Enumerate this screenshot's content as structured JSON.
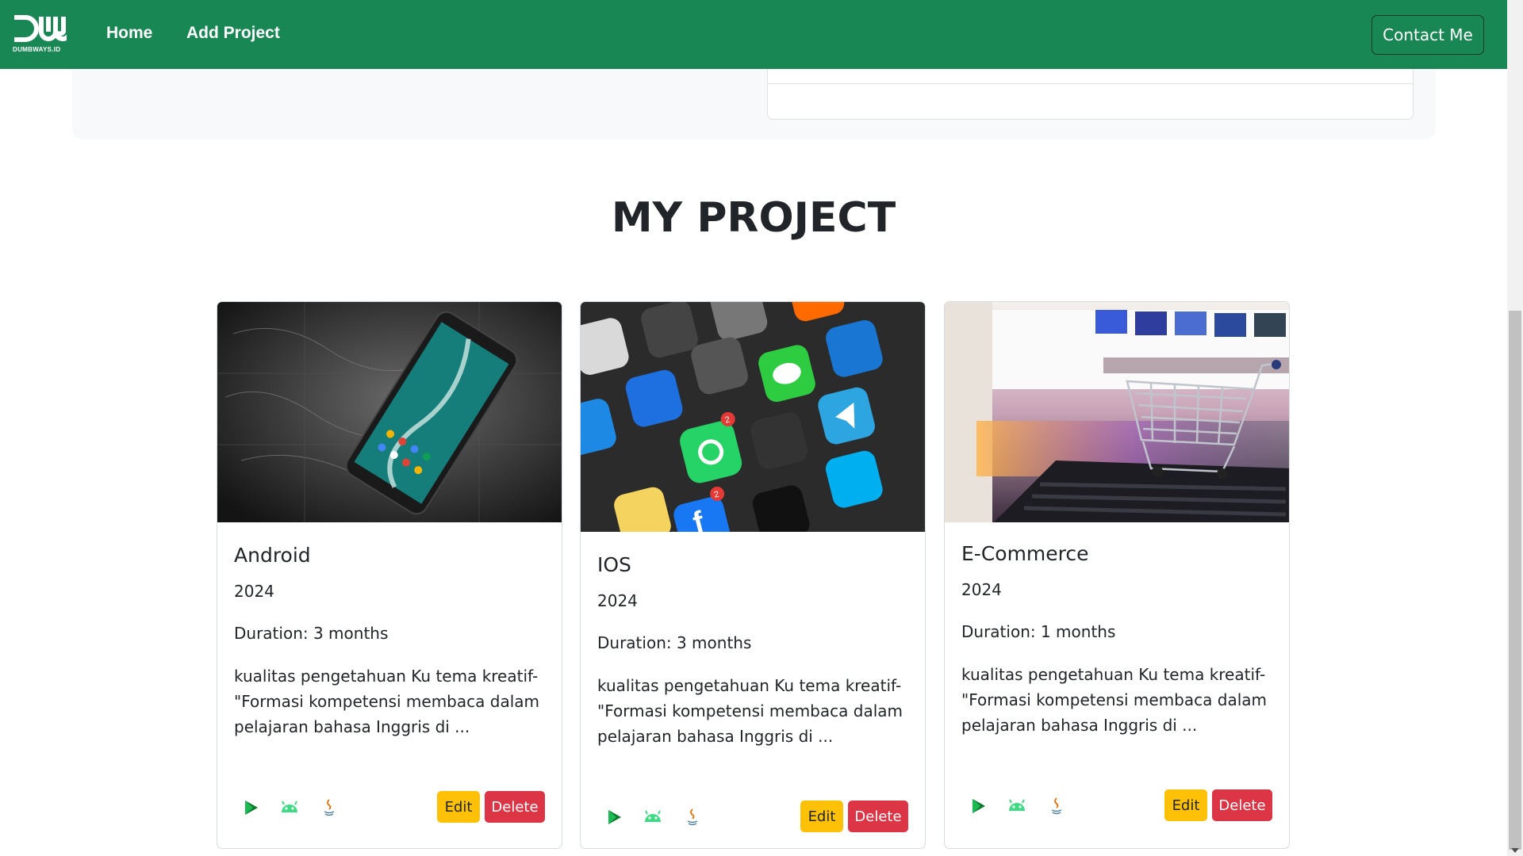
{
  "navbar": {
    "logo_text": "DUMBWAYS.ID",
    "links": [
      {
        "label": "Home"
      },
      {
        "label": "Add Project"
      }
    ],
    "contact_label": "Contact Me"
  },
  "section": {
    "title": "MY PROJECT"
  },
  "projects": [
    {
      "title": "Android",
      "year": "2024",
      "duration": "Duration: 3 months",
      "description": "kualitas pengetahuan Ku tema kreatif- \"Formasi kompetensi membaca dalam pelajaran bahasa Inggris di ...",
      "tech_icons": [
        "google-play-icon",
        "android-icon",
        "java-icon"
      ],
      "edit_label": "Edit",
      "delete_label": "Delete"
    },
    {
      "title": "IOS",
      "year": "2024",
      "duration": "Duration: 3 months",
      "description": "kualitas pengetahuan Ku tema kreatif- \"Formasi kompetensi membaca dalam pelajaran bahasa Inggris di ...",
      "tech_icons": [
        "google-play-icon",
        "android-icon",
        "java-icon"
      ],
      "edit_label": "Edit",
      "delete_label": "Delete"
    },
    {
      "title": "E-Commerce",
      "year": "2024",
      "duration": "Duration: 1 months",
      "description": "kualitas pengetahuan Ku tema kreatif- \"Formasi kompetensi membaca dalam pelajaran bahasa Inggris di ...",
      "tech_icons": [
        "google-play-icon",
        "android-icon",
        "java-icon"
      ],
      "edit_label": "Edit",
      "delete_label": "Delete"
    }
  ],
  "colors": {
    "navbar": "#198754",
    "edit_button": "#ffc107",
    "delete_button": "#dc3545",
    "android_green": "#3ddc84"
  }
}
